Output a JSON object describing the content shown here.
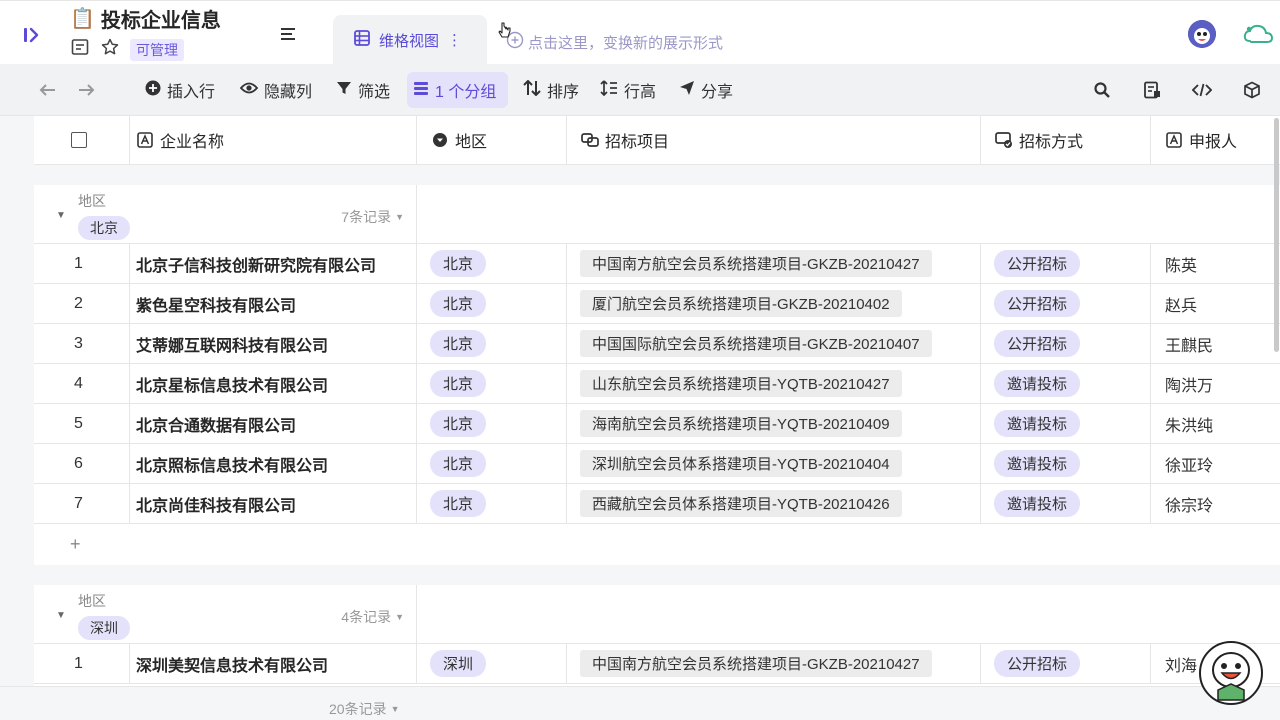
{
  "header": {
    "doc_emoji": "📋",
    "title": "投标企业信息",
    "permission_badge": "可管理",
    "view_tab_label": "维格视图",
    "view_tab_more": "⋮",
    "add_view_hint": "点击这里，变换新的展示形式"
  },
  "toolbar": {
    "insert_row": "插入行",
    "hide_columns": "隐藏列",
    "filter": "筛选",
    "group": "1 个分组",
    "sort": "排序",
    "row_height": "行高",
    "share": "分享"
  },
  "columns": {
    "company": "企业名称",
    "region": "地区",
    "project": "招标项目",
    "method": "招标方式",
    "applicant": "申报人"
  },
  "groups": [
    {
      "field_label": "地区",
      "tag": "北京",
      "count": "7条记录",
      "rows": [
        {
          "idx": "1",
          "company": "北京子信科技创新研究院有限公司",
          "region": "北京",
          "project": "中国南方航空会员系统搭建项目-GKZB-20210427",
          "method": "公开招标",
          "applicant": "陈英"
        },
        {
          "idx": "2",
          "company": "紫色星空科技有限公司",
          "region": "北京",
          "project": "厦门航空会员系统搭建项目-GKZB-20210402",
          "method": "公开招标",
          "applicant": "赵兵"
        },
        {
          "idx": "3",
          "company": "艾蒂娜互联网科技有限公司",
          "region": "北京",
          "project": "中国国际航空会员系统搭建项目-GKZB-20210407",
          "method": "公开招标",
          "applicant": "王麒民"
        },
        {
          "idx": "4",
          "company": "北京星标信息技术有限公司",
          "region": "北京",
          "project": "山东航空会员系统搭建项目-YQTB-20210427",
          "method": "邀请投标",
          "applicant": "陶洪万"
        },
        {
          "idx": "5",
          "company": "北京合通数据有限公司",
          "region": "北京",
          "project": "海南航空会员系统搭建项目-YQTB-20210409",
          "method": "邀请投标",
          "applicant": "朱洪纯"
        },
        {
          "idx": "6",
          "company": "北京照标信息技术有限公司",
          "region": "北京",
          "project": "深圳航空会员体系搭建项目-YQTB-20210404",
          "method": "邀请投标",
          "applicant": "徐亚玲"
        },
        {
          "idx": "7",
          "company": "北京尚佳科技有限公司",
          "region": "北京",
          "project": "西藏航空会员体系搭建项目-YQTB-20210426",
          "method": "邀请投标",
          "applicant": "徐宗玲"
        }
      ],
      "add_label": "+"
    },
    {
      "field_label": "地区",
      "tag": "深圳",
      "count": "4条记录",
      "rows": [
        {
          "idx": "1",
          "company": "深圳美契信息技术有限公司",
          "region": "深圳",
          "project": "中国南方航空会员系统搭建项目-GKZB-20210427",
          "method": "公开招标",
          "applicant": "刘海"
        }
      ]
    }
  ],
  "footer": {
    "total": "20条记录"
  },
  "colors": {
    "accent": "#5b4bd8",
    "tag_bg": "#e4e2fb",
    "project_bg": "#ececec"
  }
}
